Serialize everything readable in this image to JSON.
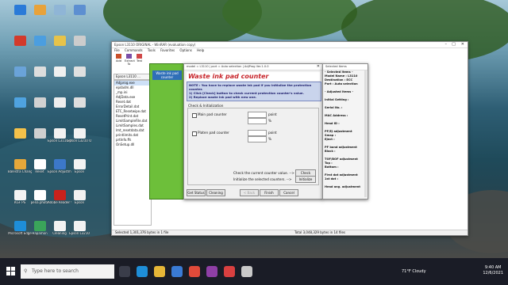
{
  "desktop_icons": [
    {
      "label": "",
      "color": "#2a7ad8"
    },
    {
      "label": "",
      "color": "#e8a23a"
    },
    {
      "label": "",
      "color": "#8fb5d6"
    },
    {
      "label": "",
      "color": "#5d8fd1"
    },
    {
      "label": "",
      "color": "#d33a2c"
    },
    {
      "label": "",
      "color": "#4b9ee0"
    },
    {
      "label": "",
      "color": "#e7c34a"
    },
    {
      "label": "",
      "color": "#cccccc"
    },
    {
      "label": "",
      "color": "#6aa3d9"
    },
    {
      "label": "",
      "color": "#dddddd"
    },
    {
      "label": "",
      "color": "#f0f0f0"
    },
    {
      "label": "",
      "color": "#e0e0e0"
    },
    {
      "label": "",
      "color": "#4fa3e0"
    },
    {
      "label": "",
      "color": "#d1d1d1"
    },
    {
      "label": "",
      "color": "#eeeeee"
    },
    {
      "label": "",
      "color": "#dedede"
    },
    {
      "label": "",
      "color": "#f4c14a"
    },
    {
      "label": "",
      "color": "#cfcfcf"
    },
    {
      "label": "Epson L3110 ORIGINAL",
      "color": "#f2f2f2"
    },
    {
      "label": "Epson L3210 ORIGINAL",
      "color": "#f2f2f2"
    },
    {
      "label": "Balestra Change",
      "color": "#e6a83a"
    },
    {
      "label": "Reset",
      "color": "#ffffff"
    },
    {
      "label": "Epson Adjustment",
      "color": "#3c78c9"
    },
    {
      "label": "Epson",
      "color": "#f2f2f2"
    },
    {
      "label": "RGF PS",
      "color": "#f2f2f2"
    },
    {
      "label": "pena.photo",
      "color": "#ffffff"
    },
    {
      "label": "Adobe Reader 9",
      "color": "#c9221c"
    },
    {
      "label": "Epson",
      "color": "#f2f2f2"
    },
    {
      "label": "Microsoft Edge",
      "color": "#1e8ed8"
    },
    {
      "label": "Hapamon",
      "color": "#3aa55a"
    },
    {
      "label": "Cleaning",
      "color": "#f2f2f2"
    },
    {
      "label": "Epson L3210",
      "color": "#f2f2f2"
    }
  ],
  "explorer": {
    "title": "Epson L3110 ORIGINAL - WinRAR (evaluation copy)",
    "menu": [
      "File",
      "Commands",
      "Tools",
      "Favorites",
      "Options",
      "Help"
    ],
    "toolbar": [
      "Add",
      "Extract To",
      "Test"
    ],
    "path": "Epson L3110 ...",
    "files": [
      "Adjprog.exe",
      "epdadm.dll",
      "_mp.ini",
      "AdjData.exe",
      "Reset.dat",
      "ErrorDetail.dat",
      "ETC_Resetwipe.dat",
      "ResetPrint.dat",
      "LimitSampleFile.dat",
      "LimitSamples.dat",
      "lmt_resetdata.dat",
      "printlimits.dat",
      "prtInfo.ffs",
      "OnSetup.dll"
    ],
    "status_left": "Selected 1,301,376 bytes in 1 file",
    "status_right": "Total 3,048,329 bytes in 14 files"
  },
  "green_panel": {
    "label": "Waste ink pad counter"
  },
  "dialog": {
    "title": "model = L3110 | port = Auto selection | AdjProg Ver.1.0.0",
    "heading": "Waste ink pad counter",
    "note": [
      "NOTE : You have to replace waste ink pad if you initialize the protection counter.",
      "1) Click [Check] button to check current protection counter's value.",
      "2) Replace waste ink pad with new one."
    ],
    "section": "Check & Initialization",
    "main_pad": "Main pad counter",
    "platen_pad": "Platen pad counter",
    "point": "point",
    "percent": "%",
    "check_text": "Check the current counter value.  -->",
    "init_text": "Initialize the selected counters.  -->",
    "check_btn": "Check",
    "init_btn": "Initialize",
    "get_status": "Get Status",
    "cleaning": "Cleaning",
    "back": "< Back",
    "finish": "Finish",
    "cancel": "Cancel"
  },
  "side_panel": {
    "title": "Selected Items",
    "items": [
      "- Selected items -",
      "Model Name : L3110",
      "Destination : ECC",
      "Port : Auto selection",
      "",
      "- Adjusted items -",
      "",
      "Initial Setting :",
      "",
      "Serial No. :",
      "",
      "MAC Address :",
      "",
      "Head ID :",
      "",
      "PF/EJ adjustment",
      "  Smap :",
      "  Eject :",
      "",
      "PF band adjustment",
      "  Black :",
      "",
      "TOF/BOF adjustment",
      "  Top :",
      "  Bottom :",
      "",
      "First dot adjustment",
      "  1st dot :",
      "",
      "Head ang. adjustment"
    ]
  },
  "taskbar": {
    "search_placeholder": "Type here to search",
    "weather": "71°F  Cloudy",
    "time": "9:40 AM",
    "date": "12/6/2021",
    "colors": {
      "bg": "#1a1c26",
      "accent": "#3a8ee6"
    }
  }
}
